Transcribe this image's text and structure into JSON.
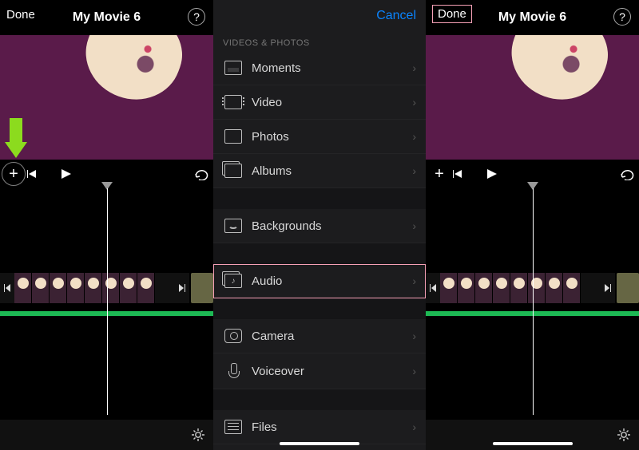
{
  "left": {
    "done": "Done",
    "title": "My Movie 6",
    "help": "?",
    "plus_icon": "+"
  },
  "right": {
    "done": "Done",
    "title": "My Movie 6",
    "help": "?",
    "plus_icon": "+"
  },
  "picker": {
    "cancel": "Cancel",
    "section": "VIDEOS & PHOTOS",
    "rows": {
      "moments": "Moments",
      "video": "Video",
      "photos": "Photos",
      "albums": "Albums",
      "backgrounds": "Backgrounds",
      "audio": "Audio",
      "camera": "Camera",
      "voiceover": "Voiceover",
      "files": "Files"
    }
  },
  "colors": {
    "accent_select": "#f6a0b6",
    "link": "#0a84ff",
    "arrow": "#8cdb1e",
    "preview_bg": "#5a1b4a",
    "audio": "#1db954"
  },
  "highlight_row": "audio"
}
